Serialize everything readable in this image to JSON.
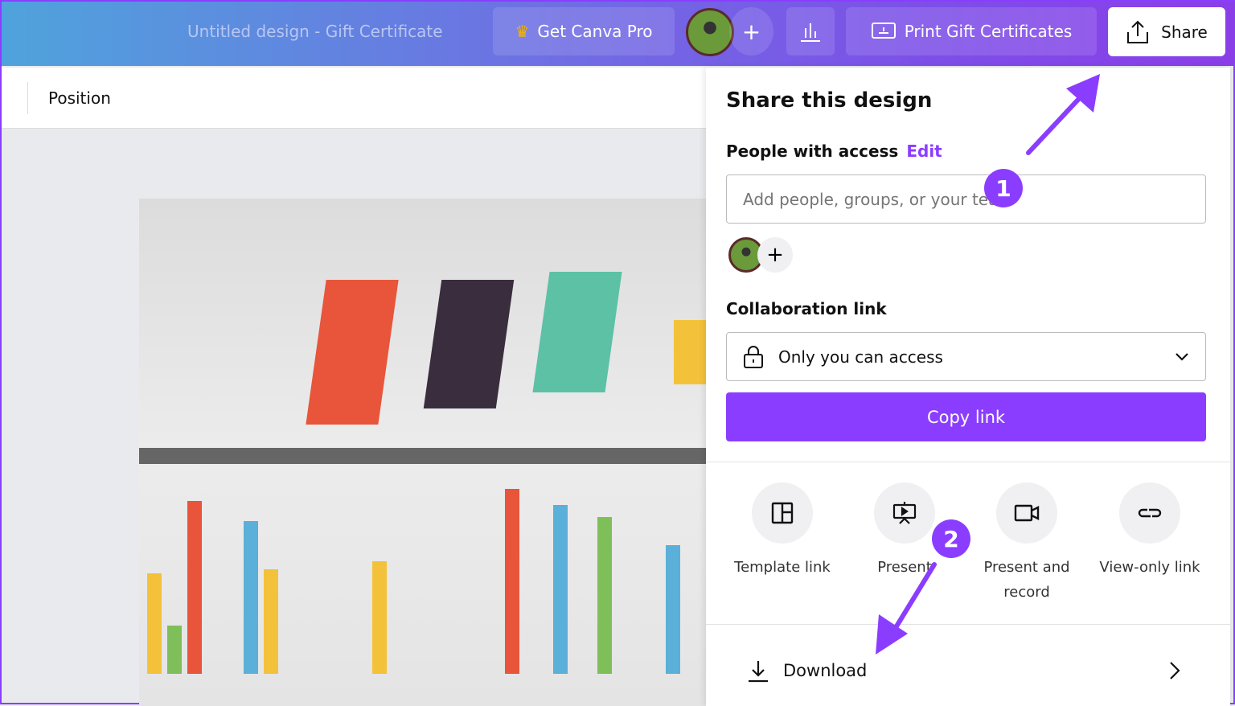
{
  "header": {
    "title": "Untitled design - Gift Certificate",
    "pro_label": "Get Canva Pro",
    "add_label": "+",
    "print_label": "Print Gift Certificates",
    "share_label": "Share"
  },
  "toolbar": {
    "position_label": "Position"
  },
  "share_panel": {
    "title": "Share this design",
    "people_label": "People with access",
    "edit_label": "Edit",
    "input_placeholder": "Add people, groups, or your team",
    "add_label": "+",
    "collab_label": "Collaboration link",
    "access_value": "Only you can access",
    "copy_label": "Copy link",
    "options": [
      {
        "label": "Template link",
        "icon": "template-icon"
      },
      {
        "label": "Present",
        "icon": "present-icon"
      },
      {
        "label": "Present and record",
        "icon": "video-icon"
      },
      {
        "label": "View-only link",
        "icon": "link-icon"
      }
    ],
    "download_label": "Download"
  },
  "annotations": {
    "badge1": "1",
    "badge2": "2"
  },
  "colors": {
    "accent": "#8b3dff"
  }
}
